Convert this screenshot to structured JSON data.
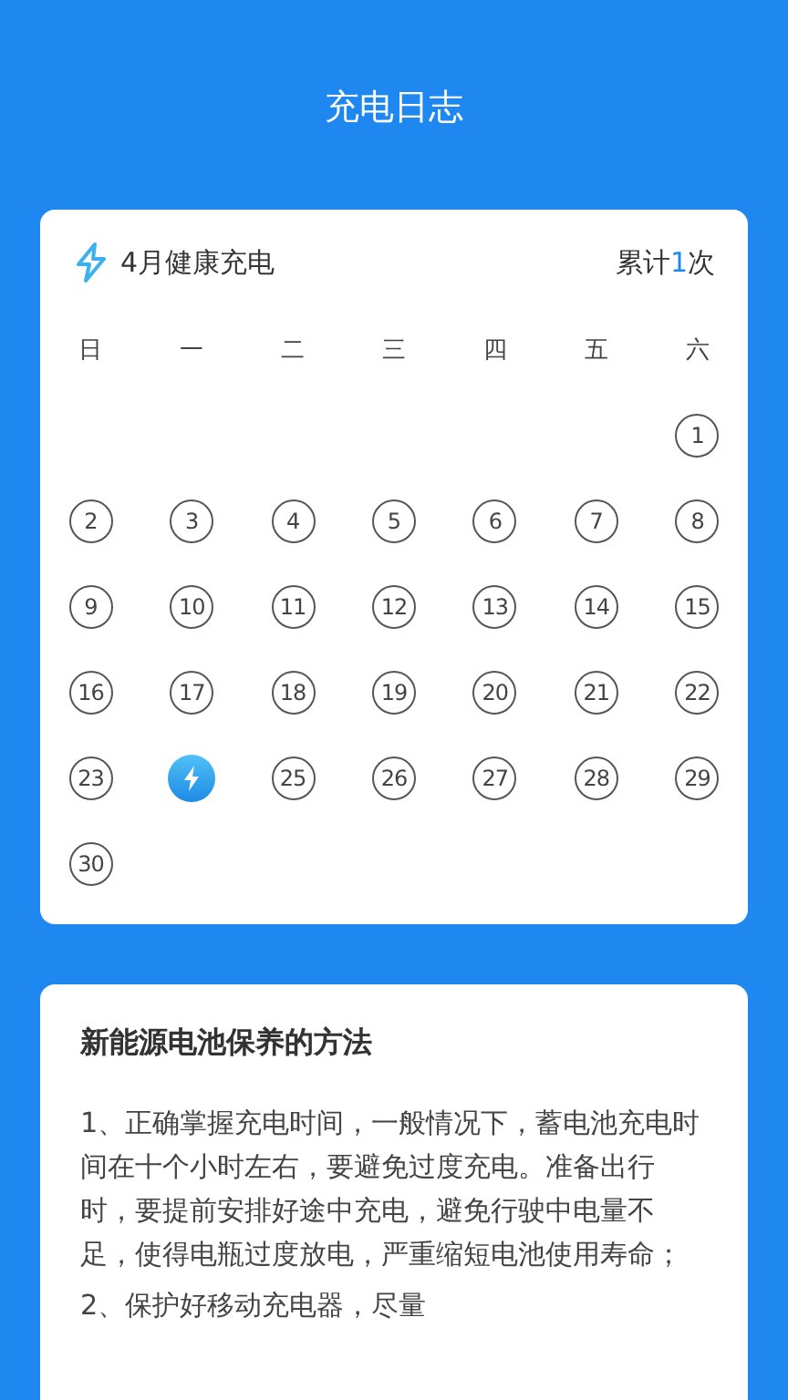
{
  "title": "充电日志",
  "calendar": {
    "month_label": "4月健康充电",
    "total_prefix": "累计",
    "total_count": "1",
    "total_suffix": "次",
    "weekdays": [
      "日",
      "一",
      "二",
      "三",
      "四",
      "五",
      "六"
    ],
    "days": [
      {
        "label": "1",
        "charged": false
      },
      {
        "label": "2",
        "charged": false
      },
      {
        "label": "3",
        "charged": false
      },
      {
        "label": "4",
        "charged": false
      },
      {
        "label": "5",
        "charged": false
      },
      {
        "label": "6",
        "charged": false
      },
      {
        "label": "7",
        "charged": false
      },
      {
        "label": "8",
        "charged": false
      },
      {
        "label": "9",
        "charged": false
      },
      {
        "label": "10",
        "charged": false
      },
      {
        "label": "11",
        "charged": false
      },
      {
        "label": "12",
        "charged": false
      },
      {
        "label": "13",
        "charged": false
      },
      {
        "label": "14",
        "charged": false
      },
      {
        "label": "15",
        "charged": false
      },
      {
        "label": "16",
        "charged": false
      },
      {
        "label": "17",
        "charged": false
      },
      {
        "label": "18",
        "charged": false
      },
      {
        "label": "19",
        "charged": false
      },
      {
        "label": "20",
        "charged": false
      },
      {
        "label": "21",
        "charged": false
      },
      {
        "label": "22",
        "charged": false
      },
      {
        "label": "23",
        "charged": false
      },
      {
        "charged": true
      },
      {
        "label": "25",
        "charged": false
      },
      {
        "label": "26",
        "charged": false
      },
      {
        "label": "27",
        "charged": false
      },
      {
        "label": "28",
        "charged": false
      },
      {
        "label": "29",
        "charged": false
      },
      {
        "label": "30",
        "charged": false
      }
    ]
  },
  "tips": {
    "heading": "新能源电池保养的方法",
    "paragraphs": [
      "1、正确掌握充电时间，一般情况下，蓄电池充电时间在十个小时左右，要避免过度充电。准备出行时，要提前安排好途中充电，避免行驶中电量不足，使得电瓶过度放电，严重缩短电池使用寿命；",
      "2、保护好移动充电器，尽量"
    ]
  }
}
